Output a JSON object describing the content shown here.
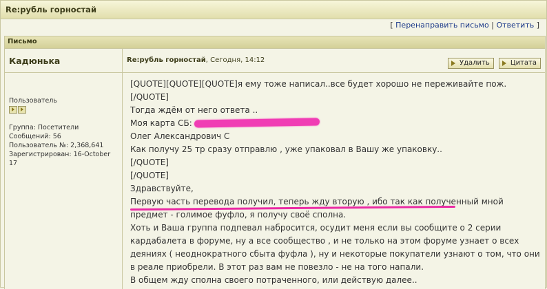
{
  "page": {
    "title": "Re:рубль горностай",
    "links": {
      "open_bracket": "[",
      "forward": "Перенаправить письмо",
      "separator": "|",
      "reply": "Ответить",
      "close_bracket": "]"
    }
  },
  "box": {
    "header": "Письмо"
  },
  "author": {
    "name": "Кадюнька",
    "role": "Пользователь",
    "group": "Группа: Посетители",
    "messages": "Сообщений: 56",
    "user_no": "Пользователь №: 2,368,641",
    "registered": "Зарегистрирован: 16-October 17"
  },
  "post": {
    "subject": "Re:рубль горностай",
    "date": ", Сегодня, 14:12",
    "delete_label": "Удалить",
    "quote_label": "Цитата",
    "lines": [
      "[QUOTE][QUOTE][QUOTE]я ему тоже написал..все будет хорошо не переживайте пож.",
      "[/QUOTE]",
      "Тогда ждём от него ответа ..",
      "Моя карта СБ:",
      "Олег Александрович С",
      "Как получу 25 тр сразу отправлю , уже упаковал в Вашу же упаковку..",
      "[/QUOTE]",
      "[/QUOTE]",
      "Здравствуйте,",
      "Первую часть перевода получил, теперь жду вторую , ибо так как полученный мной предмет - голимое фуфло, я получу своё сполна.",
      "Хоть и Ваша группа подпевал набросится, осудит меня если вы сообщите о 2 серии кардабалета в форуме, ну а все сообщество , и не только на этом форуме узнает о всех деяниях ( неоднократного сбыта фуфла ), ну и некоторые покупатели узнают о том, что они в реале приобрели. В этот раз вам не повезло - не на того напали.",
      "В общем жду сполна своего потраченного, или действую далее.."
    ]
  },
  "colors": {
    "background": "#f4f4e6",
    "border": "#c9c7a0",
    "highlight": "#ea2aa4"
  }
}
